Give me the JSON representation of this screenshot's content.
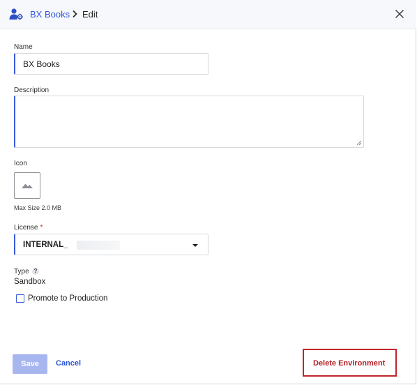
{
  "header": {
    "breadcrumb_link": "BX Books",
    "breadcrumb_current": "Edit"
  },
  "form": {
    "name_label": "Name",
    "name_value": "BX Books",
    "description_label": "Description",
    "description_value": "",
    "icon_label": "Icon",
    "icon_max_size": "Max Size 2.0 MB",
    "license_label": "License",
    "license_required_mark": "*",
    "license_value": "INTERNAL_",
    "type_label": "Type",
    "type_help": "?",
    "type_value": "Sandbox",
    "promote_label": "Promote to Production",
    "promote_checked": false
  },
  "footer": {
    "save_label": "Save",
    "cancel_label": "Cancel",
    "delete_label": "Delete Environment"
  },
  "colors": {
    "accent": "#3b5bdb",
    "link": "#2c55d8",
    "danger": "#c0252c",
    "save_disabled": "#a8b6f0"
  }
}
